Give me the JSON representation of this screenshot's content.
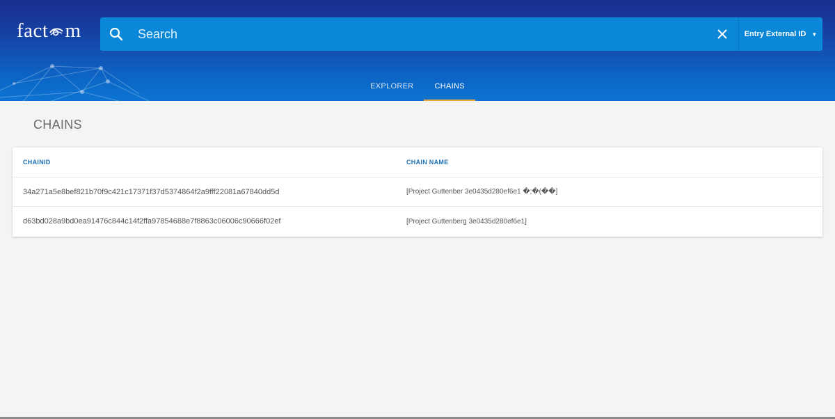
{
  "header": {
    "logo_left": "fact",
    "logo_right": "m",
    "search": {
      "placeholder": "Search",
      "type_label": "Entry External ID"
    },
    "tabs": [
      {
        "label": "EXPLORER",
        "active": false
      },
      {
        "label": "CHAINS",
        "active": true
      }
    ]
  },
  "page": {
    "title": "CHAINS"
  },
  "table": {
    "columns": [
      "CHAINID",
      "CHAIN NAME"
    ],
    "rows": [
      {
        "chain_id": "34a271a5e8bef821b70f9c421c17371f37d5374864f2a9fff22081a67840dd5d",
        "chain_name": "[Project Guttenber 3e0435d280ef6e1 �;�(��]"
      },
      {
        "chain_id": "d63bd028a9bd0ea91476c844c14f2ffa97854688e7f8863c06006c90666f02ef",
        "chain_name": "[Project Guttenberg 3e0435d280ef6e1]"
      }
    ]
  },
  "colors": {
    "header_top": "#1a2f8f",
    "header_bottom": "#0b74d2",
    "search_bg": "#0a87d6",
    "tab_indicator": "#f0a33a",
    "column_header": "#1b6fb5"
  },
  "icons": {
    "search": "search-icon",
    "close": "close-icon",
    "dropdown": "caret-down-icon"
  }
}
